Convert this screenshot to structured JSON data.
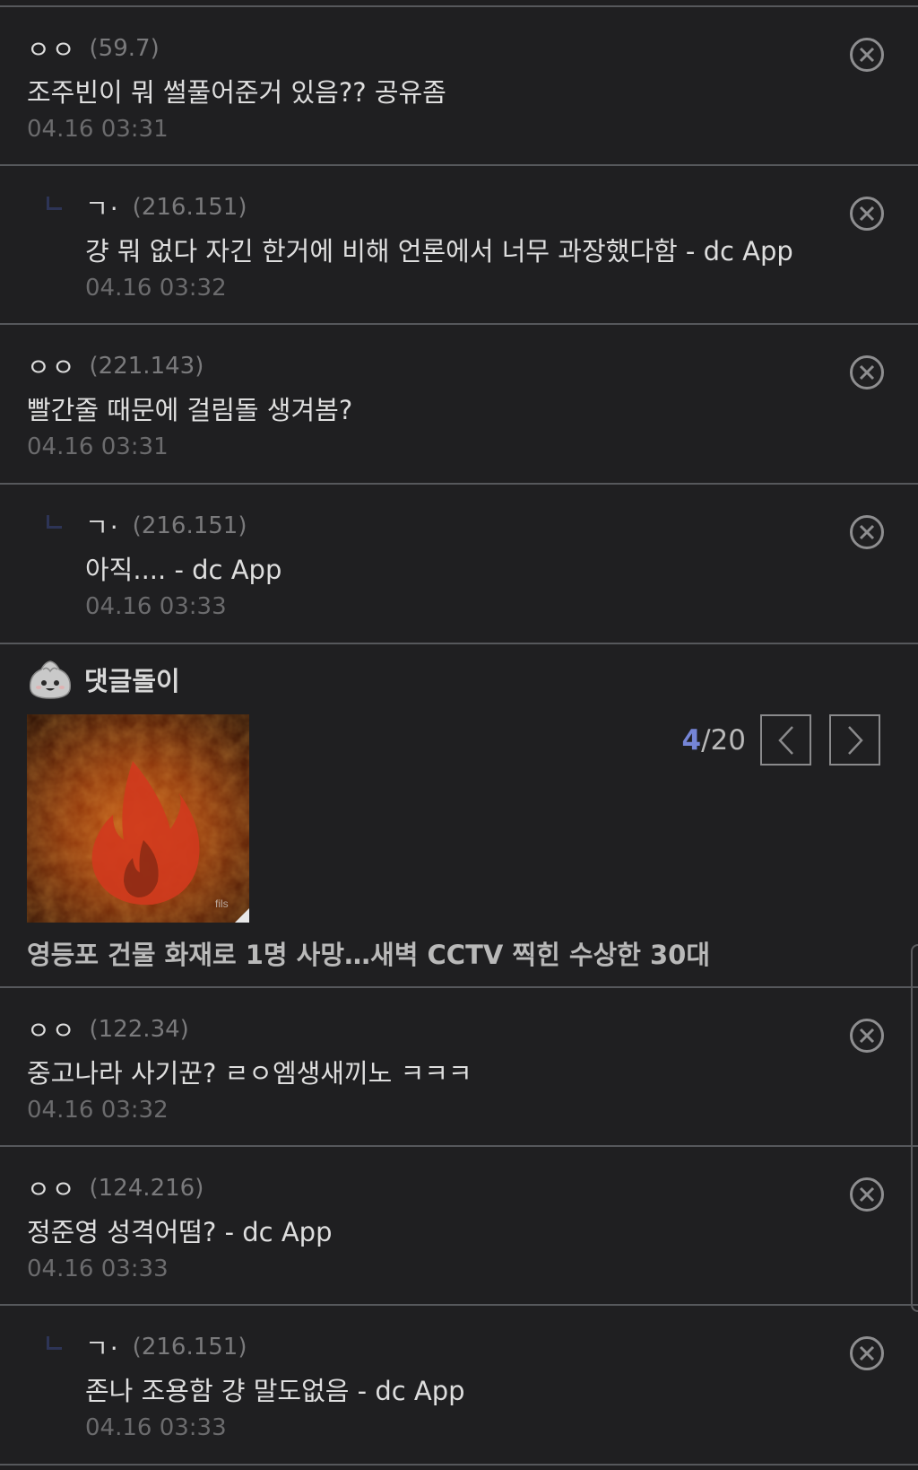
{
  "comments_top": [
    {
      "nick": "ㅇㅇ",
      "ip": "(59.7)",
      "text": "조주빈이 뭐 썰풀어준거 있음?? 공유좀",
      "date": "04.16 03:31",
      "reply": false
    },
    {
      "nick": "ㄱ·",
      "ip": "(216.151)",
      "text": "걍 뭐 없다 자긴 한거에 비해 언론에서 너무 과장했다함 - dc App",
      "date": "04.16 03:32",
      "reply": true
    },
    {
      "nick": "ㅇㅇ",
      "ip": "(221.143)",
      "text": "빨간줄 때문에 걸림돌 생겨봄?",
      "date": "04.16 03:31",
      "reply": false
    },
    {
      "nick": "ㄱ·",
      "ip": "(216.151)",
      "text": "아직.... - dc App",
      "date": "04.16 03:33",
      "reply": true
    }
  ],
  "comment_bot": {
    "title": "댓글돌이",
    "page_current": "4",
    "page_total": "/20",
    "headline": "영등포 건물 화재로 1명 사망…새벽 CCTV 찍힌 수상한 30대",
    "thumb_watermark": "fils",
    "accent_color": "#7585d6"
  },
  "comments_bottom": [
    {
      "nick": "ㅇㅇ",
      "ip": "(122.34)",
      "text": "중고나라 사기꾼? ㄹㅇ엠생새끼노 ㅋㅋㅋ",
      "date": "04.16 03:32",
      "reply": false
    },
    {
      "nick": "ㅇㅇ",
      "ip": "(124.216)",
      "text": "정준영 성격어떰? - dc App",
      "date": "04.16 03:33",
      "reply": false
    },
    {
      "nick": "ㄱ·",
      "ip": "(216.151)",
      "text": "존나 조용함 걍 말도없음 - dc App",
      "date": "04.16 03:33",
      "reply": true
    }
  ],
  "icons": {
    "delete": "delete-circle-x-icon",
    "reply": "reply-arrow-icon",
    "bot": "dumpling-mascot-icon",
    "prev": "chevron-left-icon",
    "next": "chevron-right-icon"
  }
}
